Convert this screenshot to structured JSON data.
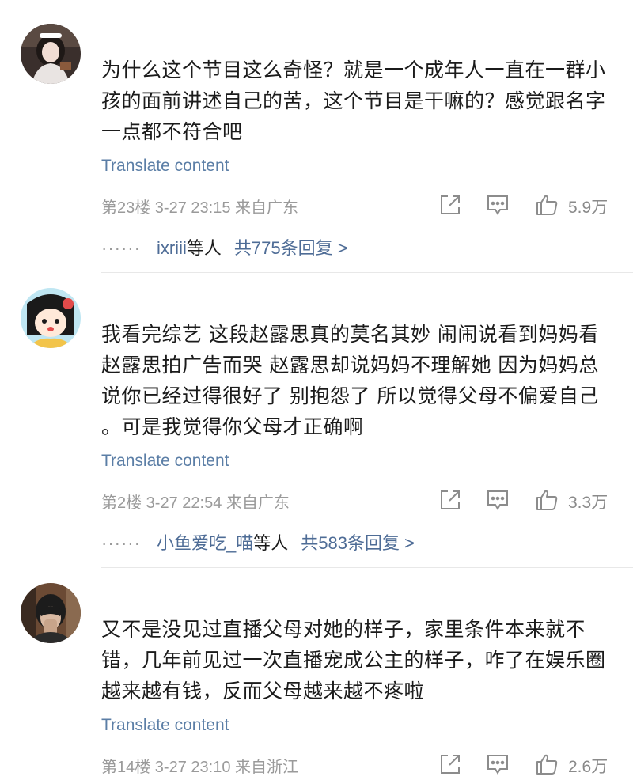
{
  "comments": [
    {
      "text": "为什么这个节目这么奇怪？就是一个成年人一直在一群小孩的面前讲述自己的苦，这个节目是干嘛的？感觉跟名字一点都不符合吧",
      "translate": "Translate content",
      "meta": "第23楼  3-27 23:15  来自广东",
      "likes": "5.9万",
      "replies": {
        "dots": "······",
        "users": "ixriii",
        "suffix": "等人",
        "count": "共775条回复 >"
      },
      "avatar_colors": {
        "bg": "#3a2f2c",
        "face": "#f1ddd4",
        "dress": "#e9e4e2"
      }
    },
    {
      "text": "我看完综艺 这段赵露思真的莫名其妙 闹闹说看到妈妈看赵露思拍广告而哭 赵露思却说妈妈不理解她 因为妈妈总说你已经过得很好了 别抱怨了 所以觉得父母不偏爱自己 。可是我觉得你父母才正确啊",
      "translate": "Translate content",
      "meta": "第2楼  3-27 22:54  来自广东",
      "likes": "3.3万",
      "replies": {
        "dots": "······",
        "users": "小鱼爱吃_喵",
        "suffix": "等人",
        "count": "共583条回复 >"
      },
      "avatar_colors": {
        "bg": "#bfe6f2",
        "hair": "#1a1a1a",
        "face": "#ffe9d9",
        "accent": "#e24b4b"
      }
    },
    {
      "text": "又不是没见过直播父母对她的样子，家里条件本来就不错，几年前见过一次直播宠成公主的样子，咋了在娱乐圈越来越有钱，反而父母越来越不疼啦",
      "translate": "Translate content",
      "meta": "第14楼  3-27 23:10  来自浙江",
      "likes": "2.6万",
      "avatar_colors": {
        "bg": "#6b4a34",
        "face": "#d9b9a2",
        "mask": "#1c1c1c"
      }
    }
  ]
}
